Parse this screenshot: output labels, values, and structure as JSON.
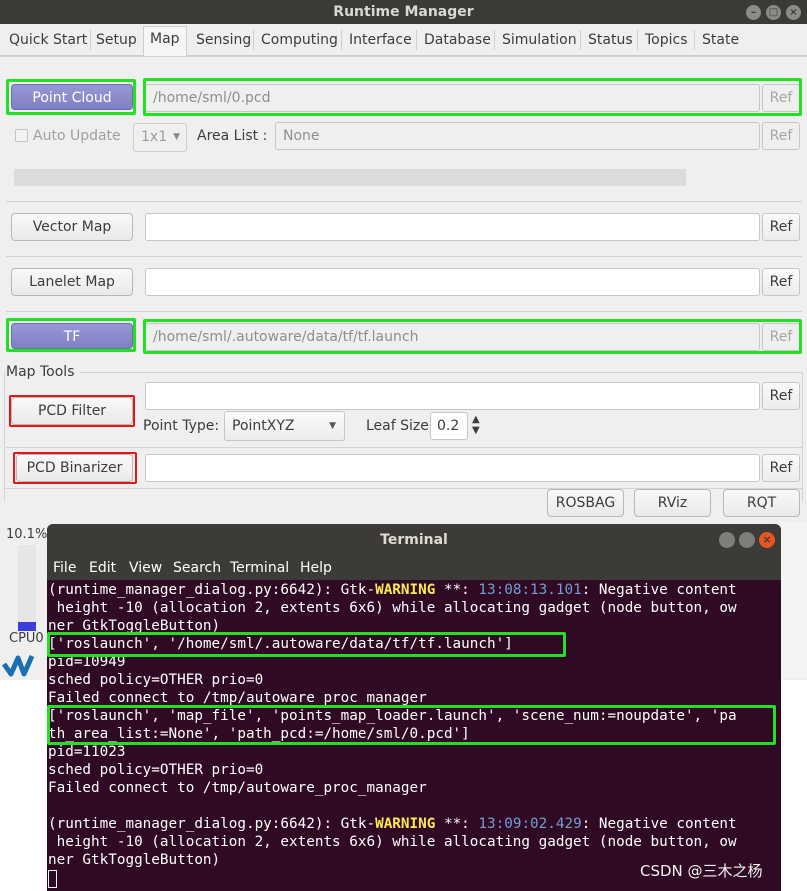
{
  "window": {
    "title": "Runtime Manager"
  },
  "tabs": [
    "Quick Start",
    "Setup",
    "Map",
    "Sensing",
    "Computing",
    "Interface",
    "Database",
    "Simulation",
    "Status",
    "Topics",
    "State"
  ],
  "active_tab": "Map",
  "map": {
    "point_cloud_button": "Point Cloud",
    "point_cloud_path": "/home/sml/0.pcd",
    "ref": "Ref",
    "auto_update": "Auto Update",
    "grid_select": "1x1",
    "area_list_label": "Area List :",
    "area_list_value": "None",
    "vector_map_button": "Vector Map",
    "lanelet_map_button": "Lanelet Map",
    "tf_button": "TF",
    "tf_path": "/home/sml/.autoware/data/tf/tf.launch",
    "map_tools_label": "Map Tools",
    "pcd_filter_button": "PCD Filter",
    "point_type_label": "Point Type:",
    "point_type_value": "PointXYZ",
    "leaf_size_label": "Leaf Size:",
    "leaf_size_value": "0.2",
    "pcd_binarizer_button": "PCD Binarizer",
    "bottom_buttons": [
      "ROSBAG",
      "RViz",
      "RQT"
    ]
  },
  "status": {
    "cpu_percent": "10.1%",
    "cpu_label": "CPU0"
  },
  "terminal": {
    "title": "Terminal",
    "menu": [
      "File",
      "Edit",
      "View",
      "Search",
      "Terminal",
      "Help"
    ],
    "line1_pre": "(runtime_manager_dialog.py:6642): Gtk-",
    "line1_warn": "WARNING",
    "line1_mid": " **: ",
    "line1_ts": "13:08:13.101",
    "line1_post": ": Negative content",
    "line2": " height -10 (allocation 2, extents 6x6) while allocating gadget (node button, ow",
    "line3": "ner GtkToggleButton)",
    "line4": "['roslaunch', '/home/sml/.autoware/data/tf/tf.launch']",
    "line5": "pid=10949",
    "line6": "sched policy=OTHER prio=0",
    "line7": "Failed connect to /tmp/autoware_proc_manager",
    "line8": "['roslaunch', 'map_file', 'points_map_loader.launch', 'scene_num:=noupdate', 'pa",
    "line9": "th_area_list:=None', 'path_pcd:=/home/sml/0.pcd']",
    "line10": "pid=11023",
    "line11": "sched policy=OTHER prio=0",
    "line12": "Failed connect to /tmp/autoware_proc_manager",
    "line14_pre": "(runtime_manager_dialog.py:6642): Gtk-",
    "line14_warn": "WARNING",
    "line14_mid": " **: ",
    "line14_ts": "13:09:02.429",
    "line14_post": ": Negative content",
    "line15": " height -10 (allocation 2, extents 6x6) while allocating gadget (node button, ow",
    "line16": "ner GtkToggleButton)"
  },
  "watermark": "CSDN @三木之杨"
}
